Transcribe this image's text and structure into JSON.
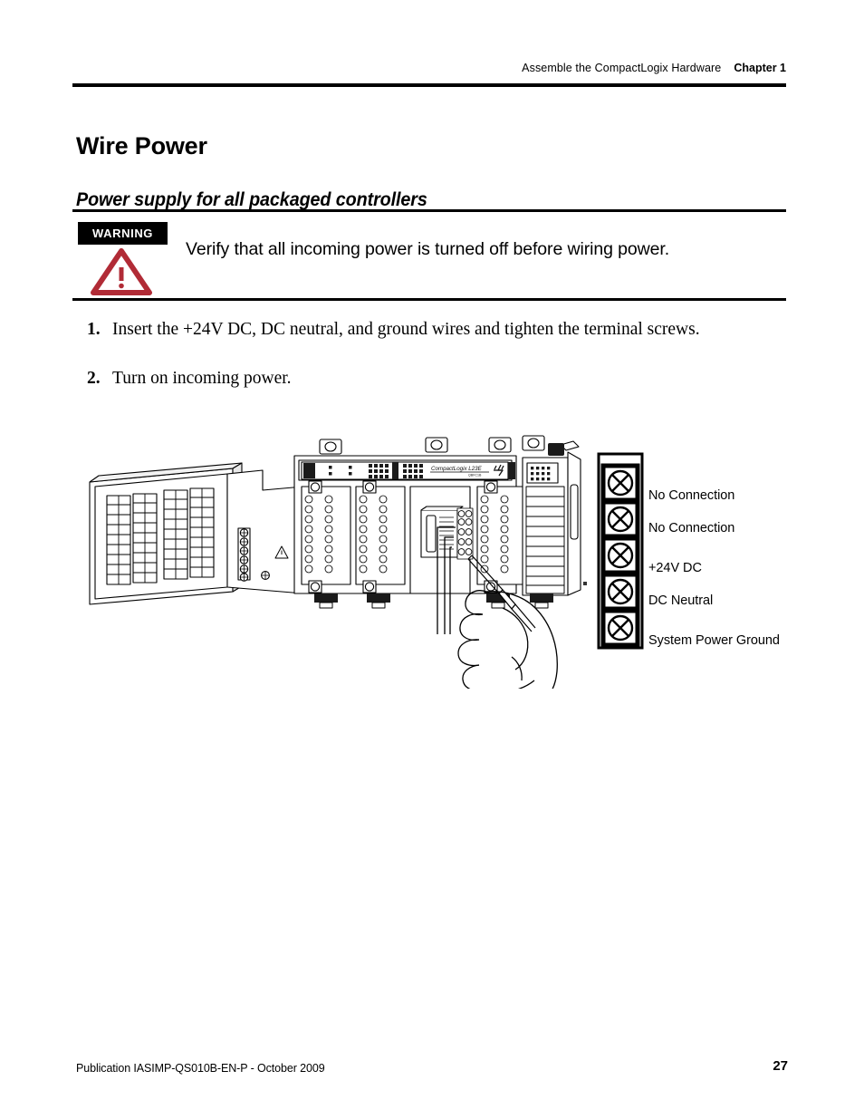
{
  "header": {
    "chapter_title": "Assemble the CompactLogix Hardware",
    "chapter_number": "Chapter 1"
  },
  "page_title": "Wire Power",
  "section_subtitle": "Power supply for all packaged controllers",
  "warning": {
    "badge_label": "WARNING",
    "text": "Verify that all incoming power is turned off before wiring power.",
    "icon": "warning-triangle-icon",
    "icon_color": "#B12B36"
  },
  "steps": [
    {
      "number": "1.",
      "text": "Insert the +24V DC, DC neutral, and ground wires and tighten the terminal screws."
    },
    {
      "number": "2.",
      "text": "Turn on incoming power."
    }
  ],
  "figure": {
    "device_label": "CompactLogix L23E",
    "device_sublabel": "QBFC1B",
    "terminal_legend": {
      "terminals": [
        {
          "label": "No Connection",
          "icon": "screw-terminal-icon"
        },
        {
          "label": "No Connection",
          "icon": "screw-terminal-icon"
        },
        {
          "label": "+24V DC",
          "icon": "screw-terminal-icon"
        },
        {
          "label": "DC Neutral",
          "icon": "screw-terminal-icon"
        },
        {
          "label": "System Power Ground",
          "icon": "screw-terminal-icon"
        }
      ]
    }
  },
  "footer": {
    "publication": "Publication IASIMP-QS010B-EN-P - October 2009",
    "page_number": "27"
  }
}
